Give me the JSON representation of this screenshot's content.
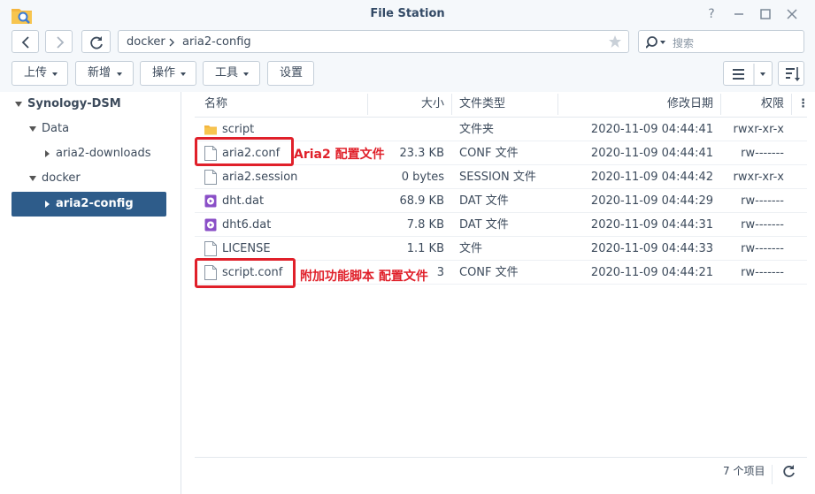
{
  "window": {
    "title": "File Station"
  },
  "nav": {
    "path": [
      "docker",
      "aria2-config"
    ],
    "search_placeholder": "搜索"
  },
  "toolbar": {
    "upload": "上传",
    "create": "新增",
    "action": "操作",
    "tools": "工具",
    "settings": "设置"
  },
  "sidebar": {
    "root": "Synology-DSM",
    "items": [
      {
        "label": "Data"
      },
      {
        "label": "aria2-downloads"
      },
      {
        "label": "docker"
      },
      {
        "label": "aria2-config"
      }
    ]
  },
  "columns": {
    "name": "名称",
    "size": "大小",
    "type": "文件类型",
    "modified": "修改日期",
    "perm": "权限"
  },
  "files": [
    {
      "name": "script",
      "size": "",
      "type": "文件夹",
      "modified": "2020-11-09 04:44:41",
      "perm": "rwxr-xr-x",
      "icon": "folder-icon"
    },
    {
      "name": "aria2.conf",
      "size": "23.3 KB",
      "type": "CONF 文件",
      "modified": "2020-11-09 04:44:41",
      "perm": "rw-------",
      "icon": "document-icon"
    },
    {
      "name": "aria2.session",
      "size": "0 bytes",
      "type": "SESSION 文件",
      "modified": "2020-11-09 04:44:42",
      "perm": "rwxr-xr-x",
      "icon": "document-icon"
    },
    {
      "name": "dht.dat",
      "size": "68.9 KB",
      "type": "DAT 文件",
      "modified": "2020-11-09 04:44:29",
      "perm": "rw-------",
      "icon": "media-icon"
    },
    {
      "name": "dht6.dat",
      "size": "7.8 KB",
      "type": "DAT 文件",
      "modified": "2020-11-09 04:44:31",
      "perm": "rw-------",
      "icon": "media-icon"
    },
    {
      "name": "LICENSE",
      "size": "1.1 KB",
      "type": "文件",
      "modified": "2020-11-09 04:44:33",
      "perm": "rw-------",
      "icon": "document-icon"
    },
    {
      "name": "script.conf",
      "size": "3",
      "type": "CONF 文件",
      "modified": "2020-11-09 04:44:21",
      "perm": "rw-------",
      "icon": "document-icon"
    }
  ],
  "annotations": {
    "aria2": "Aria2 配置文件",
    "script": "附加功能脚本 配置文件"
  },
  "footer": {
    "count": "7 个项目"
  },
  "colors": {
    "accent": "#2e5c8a",
    "annotation": "#e0202a",
    "folder": "#f4b63f",
    "media": "#8a4fc7"
  }
}
